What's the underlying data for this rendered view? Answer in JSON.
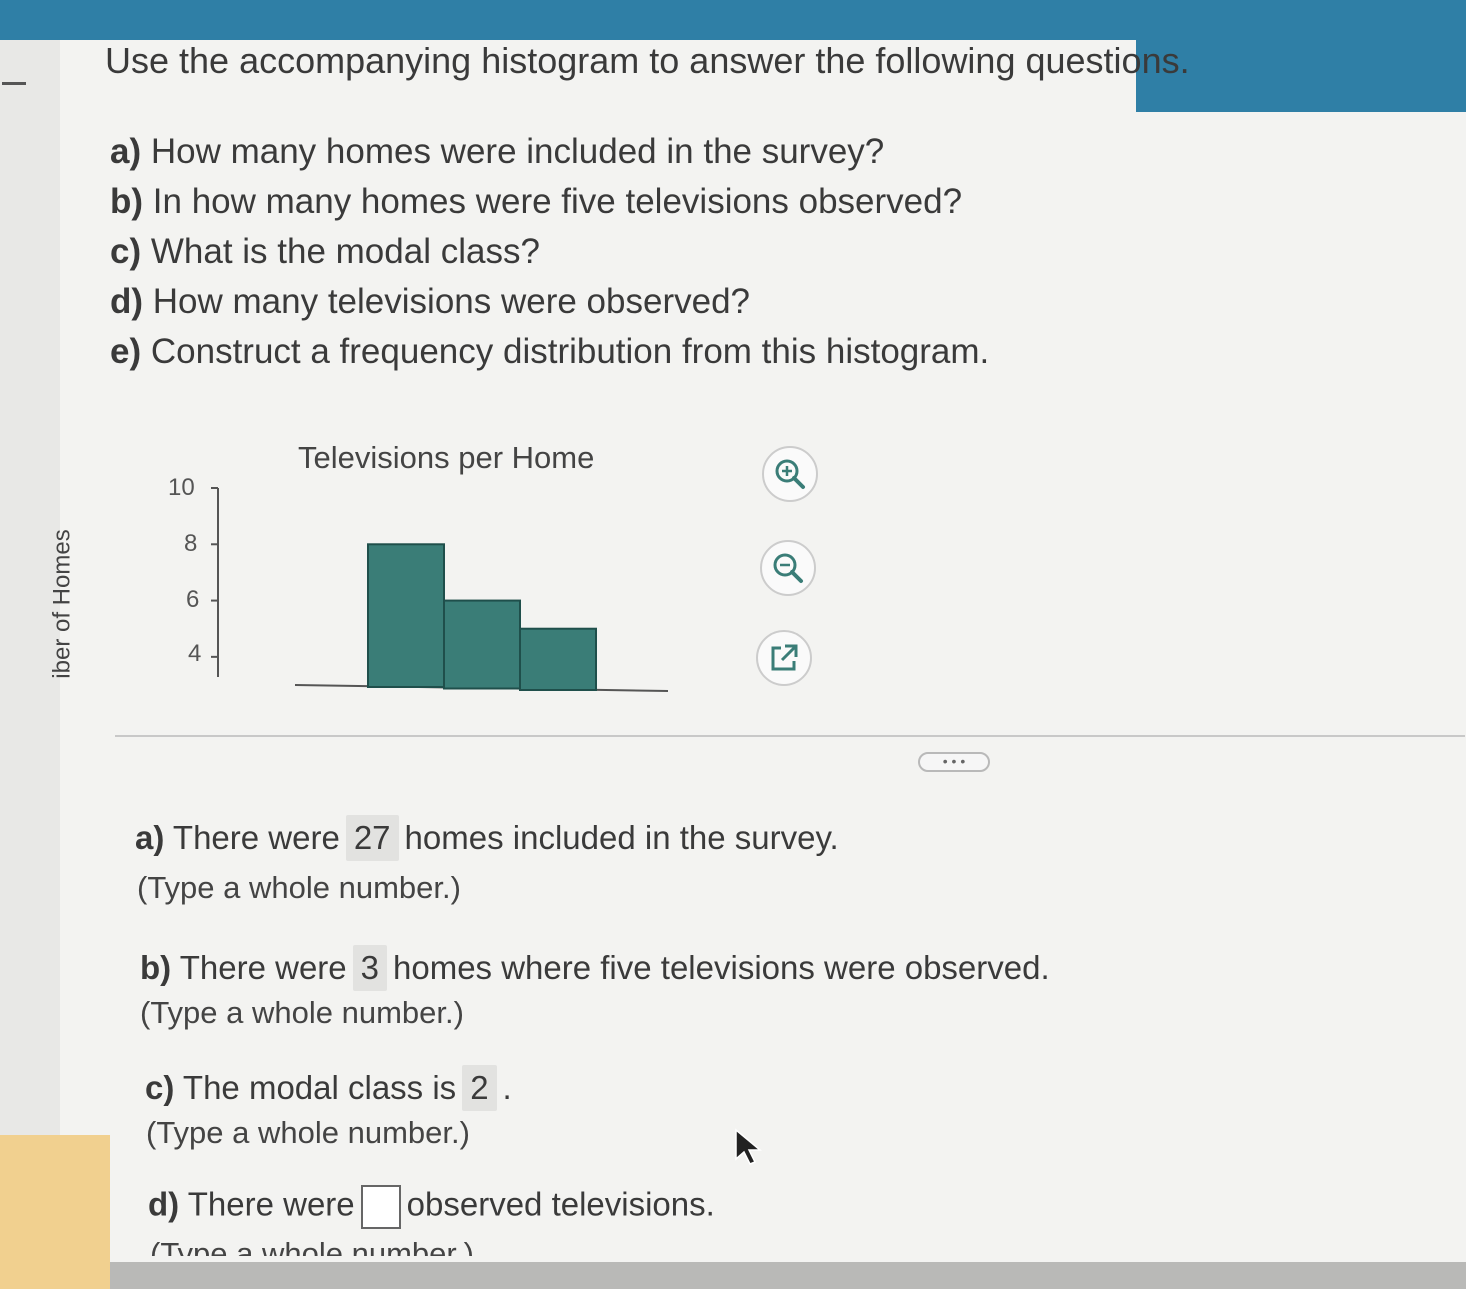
{
  "intro": "Use the accompanying histogram to answer the following questions.",
  "questions": [
    {
      "letter": "a)",
      "text": "How many homes were included in the survey?"
    },
    {
      "letter": "b)",
      "text": "In how many homes were five televisions observed?"
    },
    {
      "letter": "c)",
      "text": "What is the modal class?"
    },
    {
      "letter": "d)",
      "text": "How many televisions were observed?"
    },
    {
      "letter": "e)",
      "text": "Construct a frequency distribution from this histogram."
    }
  ],
  "chart": {
    "title": "Televisions per Home",
    "ylabel_visible": "iber of Homes",
    "ticks": [
      "10",
      "8",
      "6",
      "4"
    ]
  },
  "chart_data": {
    "type": "bar",
    "title": "Televisions per Home",
    "ylabel": "iber of Homes",
    "ylim": [
      3,
      10
    ],
    "yticks": [
      4,
      6,
      8,
      10
    ],
    "values": [
      8,
      6,
      5
    ],
    "color": "#3a7d77"
  },
  "icons": {
    "zoom_in": "zoom-in-icon",
    "zoom_out": "zoom-out-icon",
    "popout": "external-link-icon",
    "more": "more-icon"
  },
  "more_label": "• • •",
  "answers": {
    "a": {
      "letter": "a)",
      "pre": "There were",
      "value": "27",
      "post": "homes included in the survey.",
      "hint": "(Type a whole number.)"
    },
    "b": {
      "letter": "b)",
      "pre": "There were",
      "value": "3",
      "post": "homes where five televisions were observed.",
      "hint": "(Type a whole number.)"
    },
    "c": {
      "letter": "c)",
      "pre": "The modal class is",
      "value": "2",
      "post": ".",
      "hint": "(Type a whole number.)"
    },
    "d": {
      "letter": "d)",
      "pre": "There were",
      "value": "",
      "post": "observed televisions.",
      "hint": "(Type a whole number.)"
    }
  }
}
